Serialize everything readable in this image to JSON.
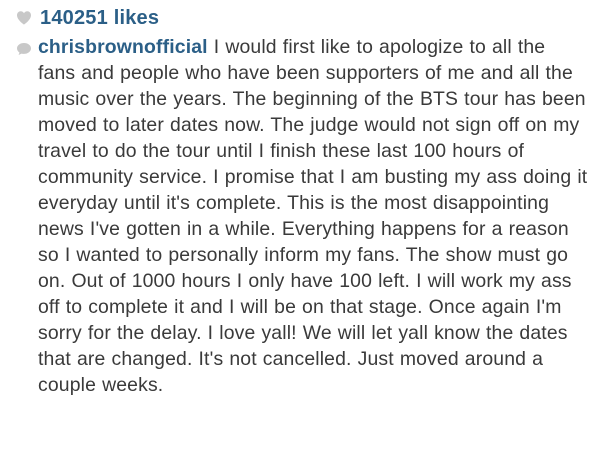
{
  "likes": {
    "icon": "heart-icon",
    "count_text": "140251 likes"
  },
  "comment": {
    "icon": "comment-bubble-icon",
    "username": "chrisbrownofficial",
    "text": "I would first like to apologize to all the fans and people who have been supporters of me and all the music over the years. The beginning of the BTS tour has been moved to later dates now. The judge would not sign off on my travel to do the tour until I finish these last 100 hours of community service. I promise that I am busting my ass doing it everyday until it's complete. This is the most disappointing news I've gotten in a while. Everything happens for a reason so I wanted to personally inform my fans. The show must go on. Out of 1000 hours I only have 100 left. I will work my ass off to complete it and I will be on that stage. Once again I'm sorry for the delay. I love yall! We will let yall know the dates that are changed. It's not cancelled. Just moved around a couple weeks."
  },
  "colors": {
    "link": "#2b5f87",
    "text": "#3a3a3a",
    "icon": "#c8c8c8",
    "background": "#ffffff"
  }
}
